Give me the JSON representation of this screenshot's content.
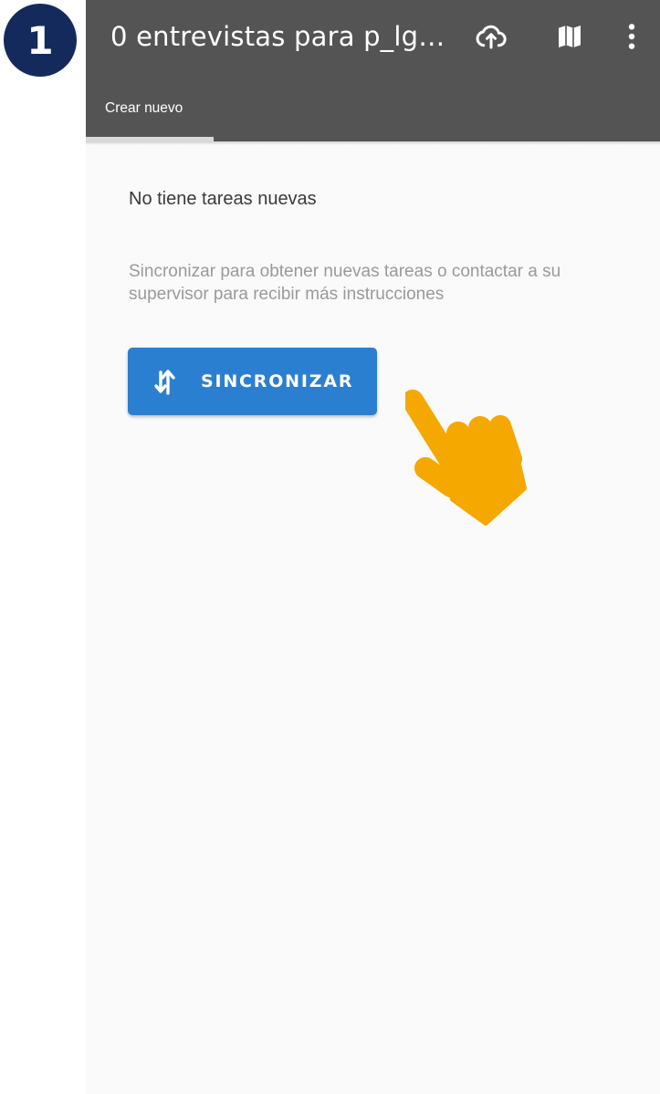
{
  "step": {
    "number": "1"
  },
  "toolbar": {
    "title": "0 entrevistas para p_lg…",
    "icons": [
      "cloud-sync-icon",
      "map-icon",
      "more-vert-icon"
    ],
    "background": "#545454"
  },
  "tabs": [
    {
      "label": "Crear nuevo",
      "selected": true
    }
  ],
  "main": {
    "empty_title": "No tiene tareas nuevas",
    "empty_hint": "Sincronizar para obtener nuevas tareas o contactar a su supervisor para recibir más instrucciones",
    "sync_button": {
      "label": "SINCRONIZAR",
      "icon": "sync-arrows-icon",
      "color": "#2b7fd0"
    }
  },
  "overlay": {
    "pointer": "hand-pointer-icon",
    "color": "#f5a800"
  },
  "colors": {
    "badge": "#152a5c",
    "accent": "#2b7fd0",
    "hand": "#f5a800"
  }
}
